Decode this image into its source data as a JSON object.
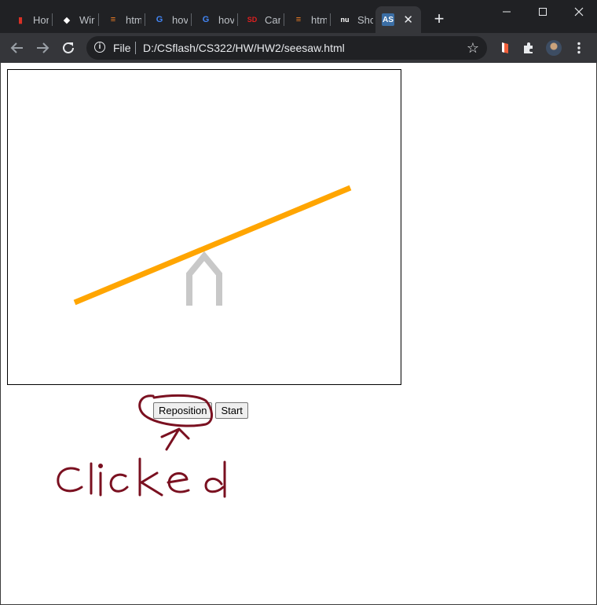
{
  "browser": {
    "tabs": [
      {
        "title": "Hor",
        "icon": "pdf-icon",
        "color": "#d93025"
      },
      {
        "title": "Wir",
        "icon": "graduation-cap-icon",
        "color": "#ffffff"
      },
      {
        "title": "htm",
        "icon": "stackoverflow-icon",
        "color": "#f48024"
      },
      {
        "title": "hov",
        "icon": "google-icon",
        "color": "#4285f4"
      },
      {
        "title": "hov",
        "icon": "google-icon",
        "color": "#4285f4"
      },
      {
        "title": "Car",
        "icon": "sd-icon",
        "color": "#e02020"
      },
      {
        "title": "htm",
        "icon": "stackoverflow-icon",
        "color": "#f48024"
      },
      {
        "title": "Sho",
        "icon": "nu-icon",
        "color": "#ffffff"
      }
    ],
    "active_tab": {
      "icon_text": "AS",
      "icon": "as-icon"
    },
    "address": {
      "scheme": "File",
      "url": "D:/CSflash/CS322/HW/HW2/seesaw.html"
    }
  },
  "page": {
    "buttons": {
      "reposition": "Reposition",
      "start": "Start"
    },
    "annotation_text": "clicked"
  },
  "colors": {
    "plank": "#ffa500",
    "fulcrum": "#c8c8c8",
    "ink": "#7a1020"
  }
}
